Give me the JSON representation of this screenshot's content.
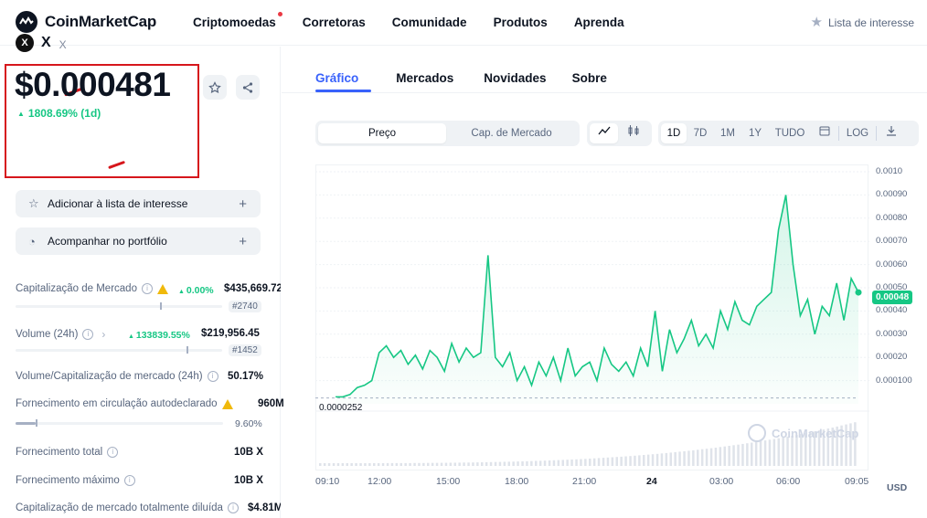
{
  "brand": {
    "name": "CoinMarketCap"
  },
  "nav": {
    "items": [
      "Criptomoedas",
      "Corretoras",
      "Comunidade",
      "Produtos",
      "Aprenda"
    ],
    "watchlist": "Lista de interesse"
  },
  "coin": {
    "icon_letter": "X",
    "name": "X",
    "symbol": "X",
    "price": "$0.000481",
    "change": "1808.69% (1d)",
    "change_color": "#16c784"
  },
  "actions": {
    "watchlist_button": "Adicionar à lista de interesse",
    "portfolio_button": "Acompanhar no portfólio"
  },
  "stats": {
    "market_cap": {
      "label": "Capitalização de Mercado",
      "change": "0.00%",
      "value": "$435,669.72",
      "rank": "#2740"
    },
    "volume": {
      "label": "Volume (24h)",
      "change": "133839.55%",
      "value": "$219,956.45",
      "rank": "#1452"
    },
    "vol_mcap": {
      "label": "Volume/Capitalização de mercado (24h)",
      "value": "50.17%"
    },
    "circulating": {
      "label": "Fornecimento em circulação autodeclarado",
      "value": "960M",
      "pct": "9.60%",
      "fill_pct": 9.6
    },
    "total_supply": {
      "label": "Fornecimento total",
      "value": "10B X"
    },
    "max_supply": {
      "label": "Fornecimento máximo",
      "value": "10B X"
    },
    "fdv": {
      "label": "Capitalização de mercado totalmente diluída",
      "value": "$4.81M"
    }
  },
  "tabs": [
    "Gráfico",
    "Mercados",
    "Novidades",
    "Sobre"
  ],
  "chart_controls": {
    "metric": [
      "Preço",
      "Cap. de Mercado"
    ],
    "ranges": [
      "1D",
      "7D",
      "1M",
      "1Y",
      "TUDO"
    ],
    "log": "LOG",
    "currency": "USD"
  },
  "chart_data": {
    "type": "area",
    "title": "",
    "xlabel": "",
    "ylabel": "",
    "y_ticks": [
      "0.0010",
      "0.00090",
      "0.00080",
      "0.00070",
      "0.00060",
      "0.00050",
      "0.00040",
      "0.00030",
      "0.00020",
      "0.000100"
    ],
    "x_ticks": [
      "09:10",
      "12:00",
      "15:00",
      "18:00",
      "21:00",
      "24",
      "03:00",
      "06:00",
      "09:05"
    ],
    "ylim": [
      0,
      0.001
    ],
    "current_price_label": "0.00048",
    "low_label": "0.0000252",
    "color": "#16c784",
    "x": [
      "09:10",
      "09:40",
      "10:10",
      "10:40",
      "11:10",
      "11:40",
      "12:00",
      "12:20",
      "12:40",
      "13:00",
      "13:20",
      "13:40",
      "14:00",
      "14:20",
      "14:40",
      "15:00",
      "15:20",
      "15:40",
      "16:00",
      "16:20",
      "16:40",
      "17:00",
      "17:20",
      "17:40",
      "18:00",
      "18:20",
      "18:40",
      "19:00",
      "19:20",
      "19:40",
      "20:00",
      "20:20",
      "20:40",
      "21:00",
      "21:20",
      "21:40",
      "22:00",
      "22:20",
      "22:40",
      "23:00",
      "23:20",
      "23:40",
      "00:00",
      "00:20",
      "00:40",
      "01:00",
      "01:20",
      "01:40",
      "02:00",
      "02:20",
      "02:40",
      "03:00",
      "03:20",
      "03:40",
      "04:00",
      "04:20",
      "04:40",
      "05:00",
      "05:20",
      "05:40",
      "06:00",
      "06:10",
      "06:20",
      "06:30",
      "06:40",
      "07:00",
      "07:20",
      "07:40",
      "08:00",
      "08:20",
      "08:40",
      "09:00",
      "09:05"
    ],
    "values": [
      3e-05,
      3e-05,
      4e-05,
      7e-05,
      8e-05,
      0.0001,
      0.00022,
      0.00025,
      0.0002,
      0.00023,
      0.00017,
      0.00021,
      0.00015,
      0.00023,
      0.0002,
      0.00014,
      0.00026,
      0.00018,
      0.00024,
      0.0002,
      0.00022,
      0.00064,
      0.0002,
      0.00016,
      0.00022,
      0.0001,
      0.00016,
      8e-05,
      0.00018,
      0.00012,
      0.0002,
      0.0001,
      0.00024,
      0.00012,
      0.00016,
      0.00018,
      0.0001,
      0.00024,
      0.00017,
      0.00014,
      0.00018,
      0.00012,
      0.00024,
      0.00016,
      0.0004,
      0.00014,
      0.00032,
      0.00022,
      0.00028,
      0.00036,
      0.00025,
      0.0003,
      0.00024,
      0.0004,
      0.00032,
      0.00044,
      0.00036,
      0.00034,
      0.00042,
      0.00045,
      0.00048,
      0.00075,
      0.0009,
      0.0006,
      0.00038,
      0.00045,
      0.0003,
      0.00042,
      0.00038,
      0.00052,
      0.00036,
      0.00054,
      0.00048
    ],
    "volume_bars": "increasing"
  }
}
